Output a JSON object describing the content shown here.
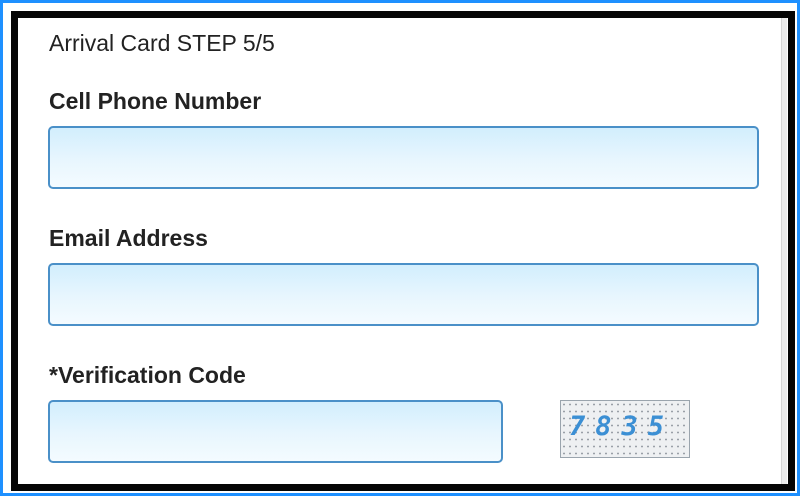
{
  "form": {
    "title": "Arrival Card STEP 5/5",
    "phone_label": "Cell Phone Number",
    "phone_value": "",
    "email_label": "Email Address",
    "email_value": "",
    "verification_label": "*Verification Code",
    "verification_value": "",
    "captcha_text": "7835"
  },
  "colors": {
    "outer_border": "#1e90ff",
    "inner_border": "#050505",
    "field_border": "#4a90c8",
    "field_fill": "#e0f3fd",
    "captcha_digits": "#3b8fd4"
  }
}
